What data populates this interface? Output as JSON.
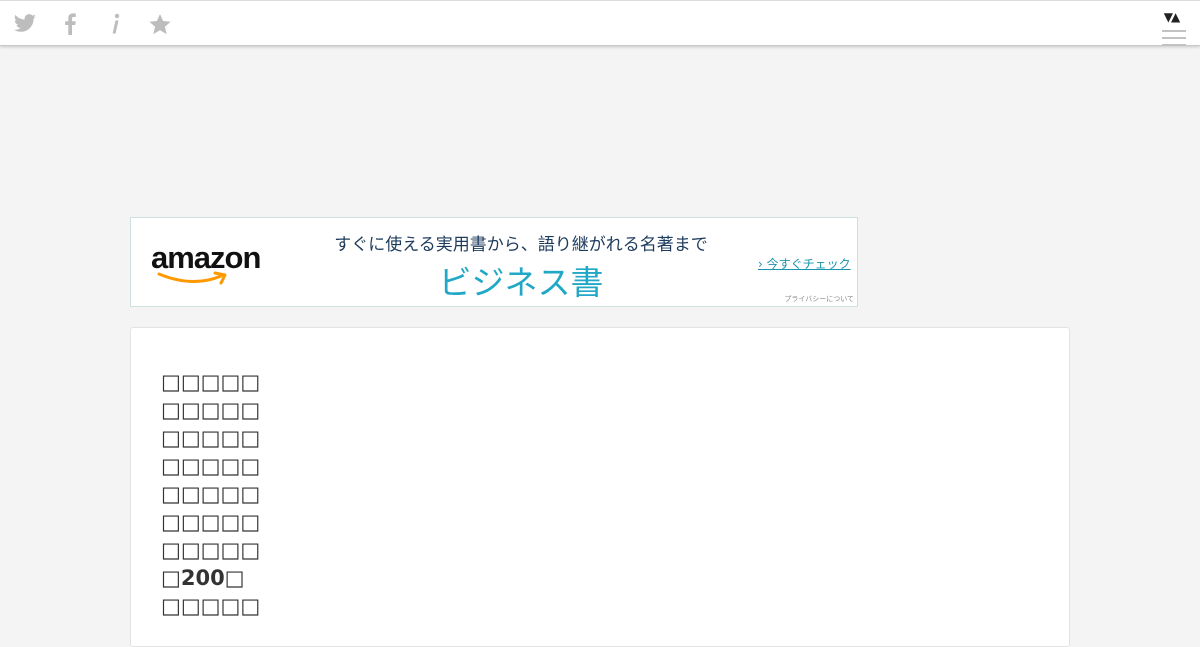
{
  "toolbar": {
    "icons": [
      "twitter-icon",
      "facebook-icon",
      "info-icon",
      "star-icon"
    ],
    "sort_label": "▼▲",
    "icon_color": "#bdbdbd"
  },
  "ad": {
    "brand": "amazon",
    "tagline": "すぐに使える実用書から、語り継がれる名著まで",
    "headline": "ビジネス書",
    "cta": "› 今すぐチェック",
    "privacy": "プライバシーについて",
    "brand_color": "#ff9900",
    "headline_color": "#21a8c6"
  },
  "content": {
    "lines": [
      "□□□□□",
      "□□□□□",
      "□□□□□",
      "□□□□□",
      "□□□□□",
      "□□□□□",
      "□□□□□",
      "□200□",
      "□□□□□"
    ]
  }
}
